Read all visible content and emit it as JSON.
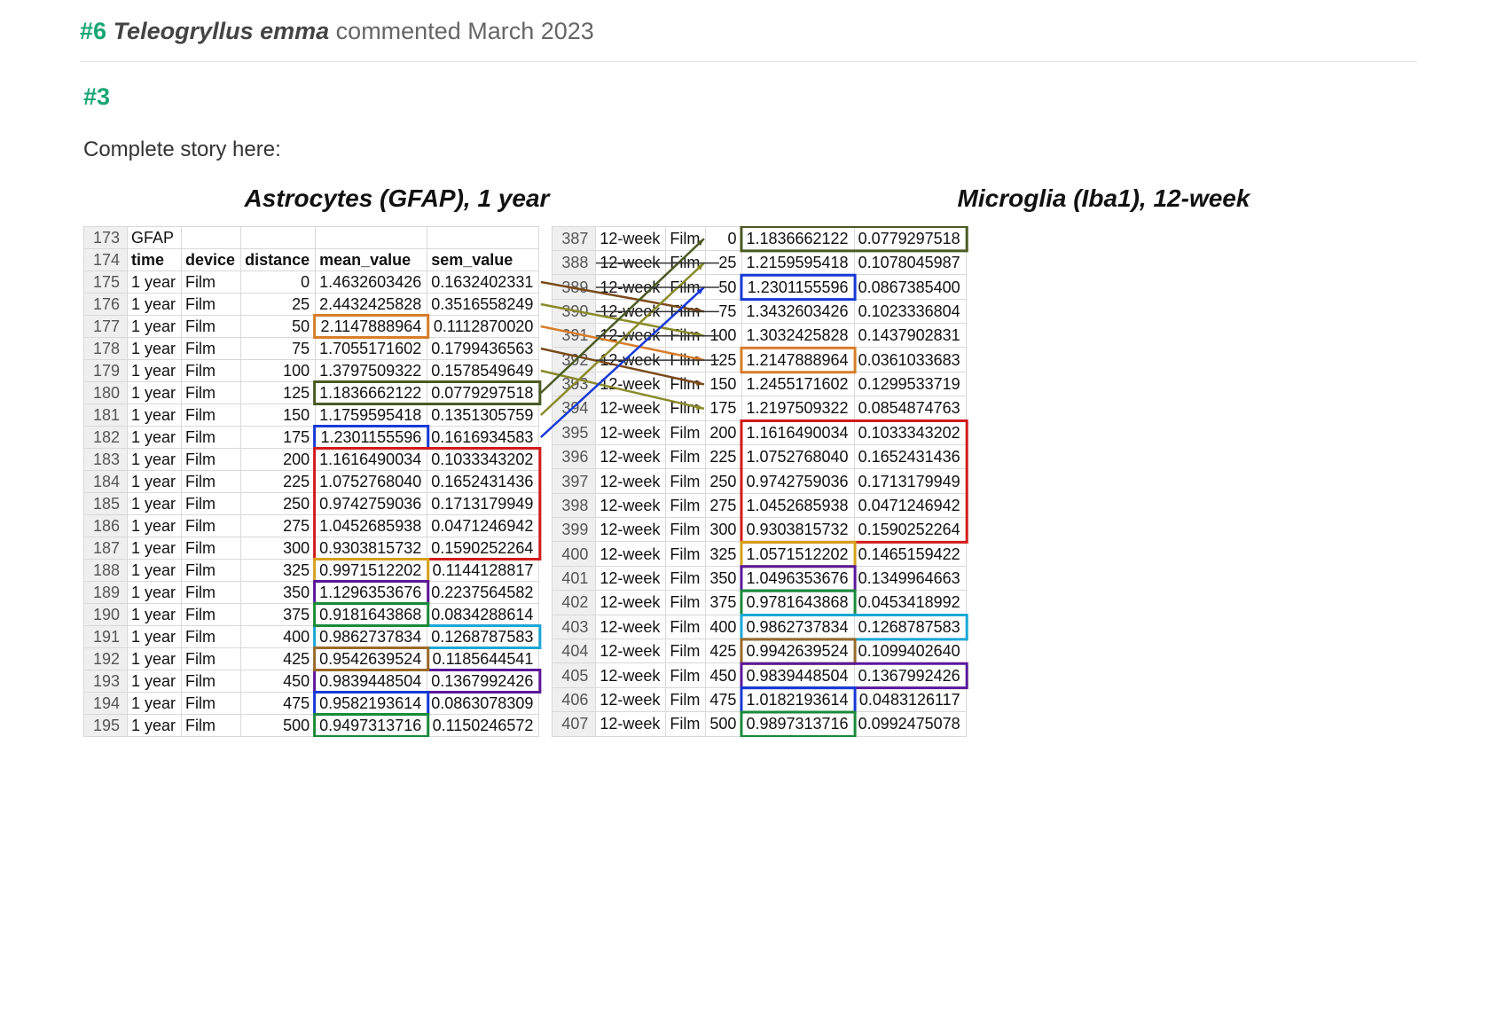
{
  "comment": {
    "number": "#6",
    "user": "Teleogryllus emma",
    "verb_date": "commented March 2023"
  },
  "reply_number": "#3",
  "body_text": "Complete story here:",
  "left_title": "Astrocytes (GFAP), 1 year",
  "right_title": "Microglia (Iba1), 12-week",
  "left_header": {
    "label_row": "GFAP",
    "cols": [
      "time",
      "device",
      "distance",
      "mean_value",
      "sem_value"
    ]
  },
  "left_rows": [
    {
      "r": "173",
      "c": [
        "GFAP",
        "",
        "",
        "",
        ""
      ]
    },
    {
      "r": "174",
      "c": [
        "time",
        "device",
        "distance",
        "mean_value",
        "sem_value"
      ],
      "hdr": true
    },
    {
      "r": "175",
      "c": [
        "1 year",
        "Film",
        "0",
        "1.4632603426",
        "0.1632402331"
      ]
    },
    {
      "r": "176",
      "c": [
        "1 year",
        "Film",
        "25",
        "2.4432425828",
        "0.3516558249"
      ]
    },
    {
      "r": "177",
      "c": [
        "1 year",
        "Film",
        "50",
        "2.1147888964",
        "0.1112870020"
      ]
    },
    {
      "r": "178",
      "c": [
        "1 year",
        "Film",
        "75",
        "1.7055171602",
        "0.1799436563"
      ]
    },
    {
      "r": "179",
      "c": [
        "1 year",
        "Film",
        "100",
        "1.3797509322",
        "0.1578549649"
      ]
    },
    {
      "r": "180",
      "c": [
        "1 year",
        "Film",
        "125",
        "1.1836662122",
        "0.0779297518"
      ]
    },
    {
      "r": "181",
      "c": [
        "1 year",
        "Film",
        "150",
        "1.1759595418",
        "0.1351305759"
      ]
    },
    {
      "r": "182",
      "c": [
        "1 year",
        "Film",
        "175",
        "1.2301155596",
        "0.1616934583"
      ]
    },
    {
      "r": "183",
      "c": [
        "1 year",
        "Film",
        "200",
        "1.1616490034",
        "0.1033343202"
      ]
    },
    {
      "r": "184",
      "c": [
        "1 year",
        "Film",
        "225",
        "1.0752768040",
        "0.1652431436"
      ]
    },
    {
      "r": "185",
      "c": [
        "1 year",
        "Film",
        "250",
        "0.9742759036",
        "0.1713179949"
      ]
    },
    {
      "r": "186",
      "c": [
        "1 year",
        "Film",
        "275",
        "1.0452685938",
        "0.0471246942"
      ]
    },
    {
      "r": "187",
      "c": [
        "1 year",
        "Film",
        "300",
        "0.9303815732",
        "0.1590252264"
      ]
    },
    {
      "r": "188",
      "c": [
        "1 year",
        "Film",
        "325",
        "0.9971512202",
        "0.1144128817"
      ]
    },
    {
      "r": "189",
      "c": [
        "1 year",
        "Film",
        "350",
        "1.1296353676",
        "0.2237564582"
      ]
    },
    {
      "r": "190",
      "c": [
        "1 year",
        "Film",
        "375",
        "0.9181643868",
        "0.0834288614"
      ]
    },
    {
      "r": "191",
      "c": [
        "1 year",
        "Film",
        "400",
        "0.9862737834",
        "0.1268787583"
      ]
    },
    {
      "r": "192",
      "c": [
        "1 year",
        "Film",
        "425",
        "0.9542639524",
        "0.1185644541"
      ]
    },
    {
      "r": "193",
      "c": [
        "1 year",
        "Film",
        "450",
        "0.9839448504",
        "0.1367992426"
      ]
    },
    {
      "r": "194",
      "c": [
        "1 year",
        "Film",
        "475",
        "0.9582193614",
        "0.0863078309"
      ]
    },
    {
      "r": "195",
      "c": [
        "1 year",
        "Film",
        "500",
        "0.9497313716",
        "0.1150246572"
      ]
    }
  ],
  "right_rows": [
    {
      "r": "387",
      "c": [
        "12-week",
        "Film",
        "0",
        "1.1836662122",
        "0.0779297518"
      ]
    },
    {
      "r": "388",
      "c": [
        "12-week",
        "Film",
        "25",
        "1.2159595418",
        "0.1078045987"
      ]
    },
    {
      "r": "389",
      "c": [
        "12-week",
        "Film",
        "50",
        "1.2301155596",
        "0.0867385400"
      ]
    },
    {
      "r": "390",
      "c": [
        "12-week",
        "Film",
        "75",
        "1.3432603426",
        "0.1023336804"
      ]
    },
    {
      "r": "391",
      "c": [
        "12-week",
        "Film",
        "100",
        "1.3032425828",
        "0.1437902831"
      ]
    },
    {
      "r": "392",
      "c": [
        "12-week",
        "Film",
        "125",
        "1.2147888964",
        "0.0361033683"
      ]
    },
    {
      "r": "393",
      "c": [
        "12-week",
        "Film",
        "150",
        "1.2455171602",
        "0.1299533719"
      ]
    },
    {
      "r": "394",
      "c": [
        "12-week",
        "Film",
        "175",
        "1.2197509322",
        "0.0854874763"
      ]
    },
    {
      "r": "395",
      "c": [
        "12-week",
        "Film",
        "200",
        "1.1616490034",
        "0.1033343202"
      ]
    },
    {
      "r": "396",
      "c": [
        "12-week",
        "Film",
        "225",
        "1.0752768040",
        "0.1652431436"
      ]
    },
    {
      "r": "397",
      "c": [
        "12-week",
        "Film",
        "250",
        "0.9742759036",
        "0.1713179949"
      ]
    },
    {
      "r": "398",
      "c": [
        "12-week",
        "Film",
        "275",
        "1.0452685938",
        "0.0471246942"
      ]
    },
    {
      "r": "399",
      "c": [
        "12-week",
        "Film",
        "300",
        "0.9303815732",
        "0.1590252264"
      ]
    },
    {
      "r": "400",
      "c": [
        "12-week",
        "Film",
        "325",
        "1.0571512202",
        "0.1465159422"
      ]
    },
    {
      "r": "401",
      "c": [
        "12-week",
        "Film",
        "350",
        "1.0496353676",
        "0.1349964663"
      ]
    },
    {
      "r": "402",
      "c": [
        "12-week",
        "Film",
        "375",
        "0.9781643868",
        "0.0453418992"
      ]
    },
    {
      "r": "403",
      "c": [
        "12-week",
        "Film",
        "400",
        "0.9862737834",
        "0.1268787583"
      ]
    },
    {
      "r": "404",
      "c": [
        "12-week",
        "Film",
        "425",
        "0.9942639524",
        "0.1099402640"
      ]
    },
    {
      "r": "405",
      "c": [
        "12-week",
        "Film",
        "450",
        "0.9839448504",
        "0.1367992426"
      ]
    },
    {
      "r": "406",
      "c": [
        "12-week",
        "Film",
        "475",
        "1.0182193614",
        "0.0483126117"
      ]
    },
    {
      "r": "407",
      "c": [
        "12-week",
        "Film",
        "500",
        "0.9897313716",
        "0.0992475078"
      ]
    }
  ]
}
